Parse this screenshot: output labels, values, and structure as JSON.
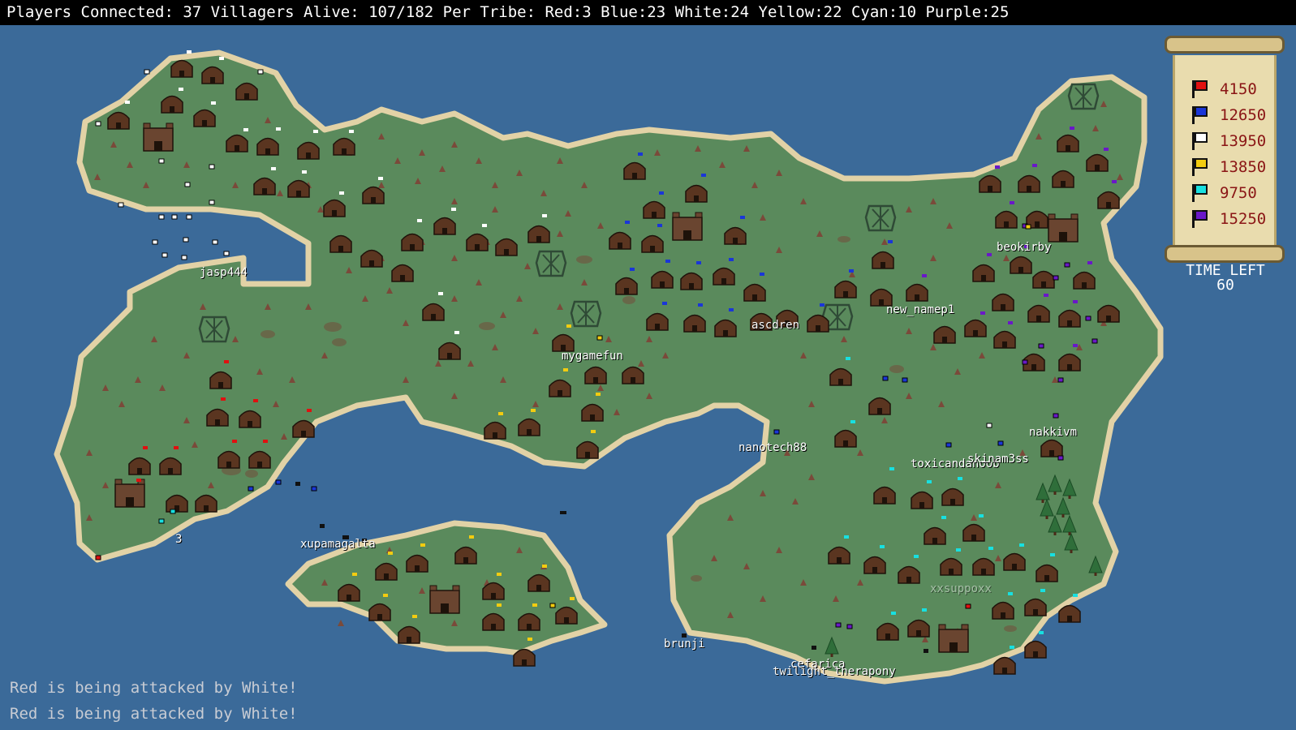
{
  "status_bar": {
    "text": "Players Connected: 37 Villagers Alive: 107/182 Per Tribe: Red:3 Blue:23 White:24 Yellow:22 Cyan:10 Purple:25"
  },
  "scoreboard": [
    {
      "tribe": "Red",
      "color": "#e01010",
      "score": "4150"
    },
    {
      "tribe": "Blue",
      "color": "#1a36d8",
      "score": "12650"
    },
    {
      "tribe": "White",
      "color": "#ffffff",
      "score": "13950"
    },
    {
      "tribe": "Yellow",
      "color": "#f2cc10",
      "score": "13850"
    },
    {
      "tribe": "Cyan",
      "color": "#18e0e0",
      "score": "9750"
    },
    {
      "tribe": "Purple",
      "color": "#6a18c8",
      "score": "15250"
    }
  ],
  "timer": {
    "label": "TIME LEFT",
    "value": "60"
  },
  "players": [
    "jasp444",
    "mygamefun",
    "ascdren",
    "new_namep1",
    "beokirby",
    "nanotech88",
    "toxicandanoob",
    "skinam3ss",
    "nakkivm",
    "xupamagalta",
    "brunji",
    "cefarica",
    "twilight_therapony",
    "xxsuppoxx",
    "3"
  ],
  "event_log": [
    "Red is being attacked by White!",
    "Red is being attacked by White!"
  ],
  "colors": {
    "ocean": "#3b6a99",
    "land": "#5a8a5c",
    "shore": "#e2d2a6",
    "hut": "#5a3520",
    "tree": "#7a4a3a",
    "pine": "#2f6e3a"
  }
}
